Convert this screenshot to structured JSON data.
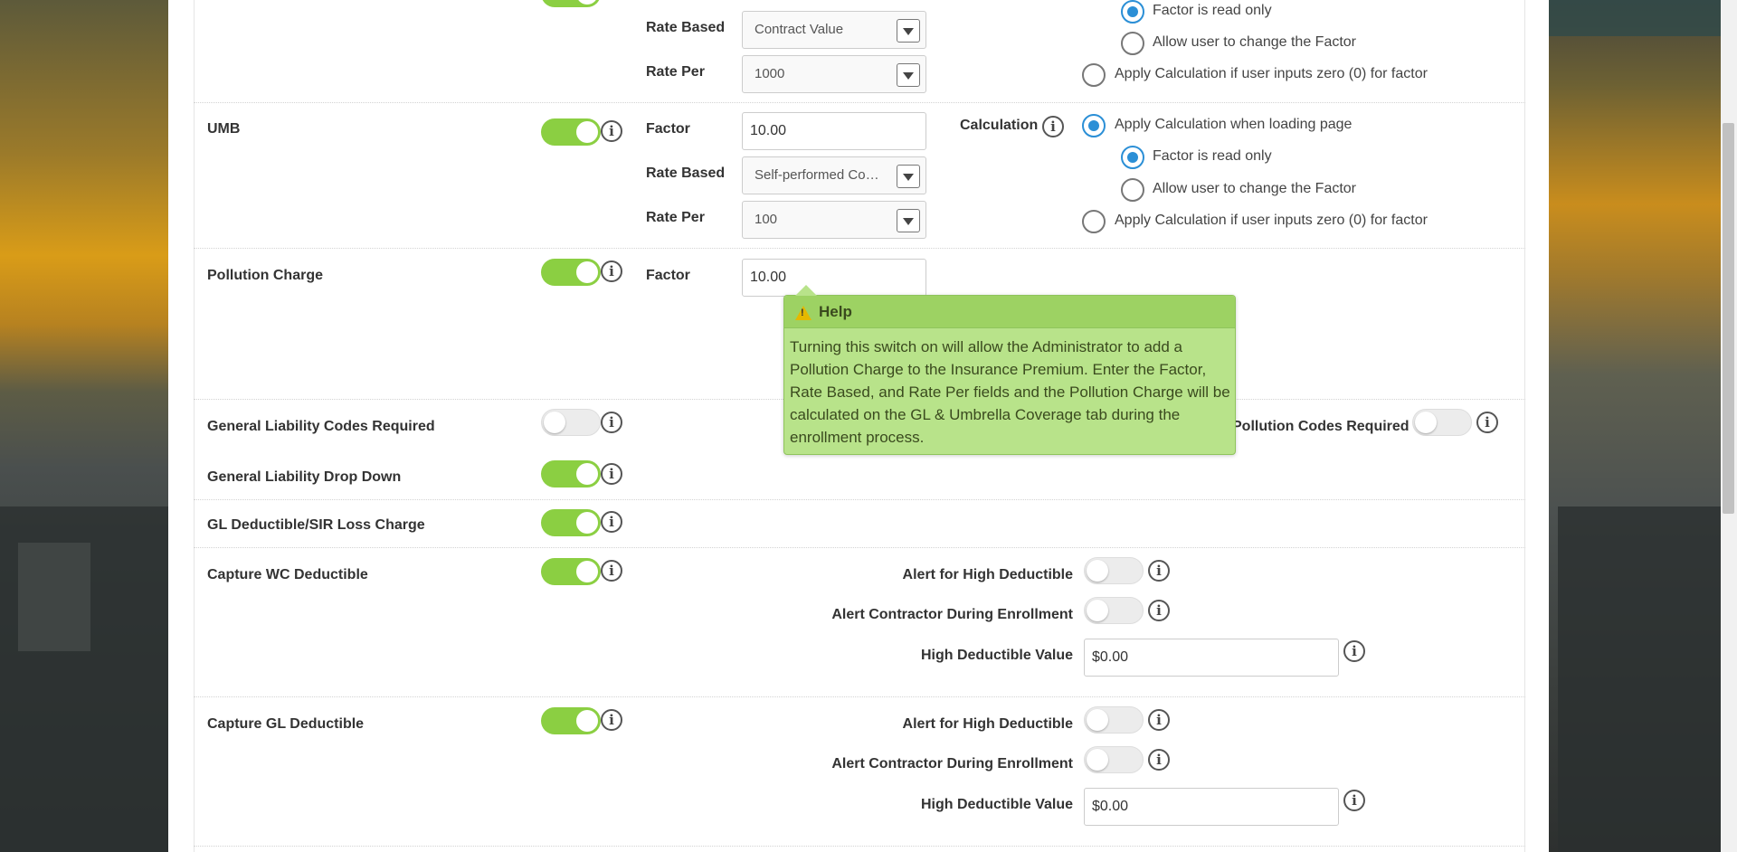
{
  "colors": {
    "toggle_on": "#8bcf42",
    "radio_selected": "#2b8fd6",
    "tooltip_bg": "#b8e38a"
  },
  "top_section": {
    "rate_based_label": "Rate Based",
    "rate_based_value": "Contract Value",
    "rate_per_label": "Rate Per",
    "rate_per_value": "1000",
    "radio_factor_read_only": "Factor is read only",
    "radio_allow_change": "Allow user to change the Factor",
    "radio_apply_zero": "Apply Calculation if user inputs zero (0) for factor",
    "factor_read_only_selected": true
  },
  "umb": {
    "label": "UMB",
    "enabled": true,
    "factor_label": "Factor",
    "factor_value": "10.00",
    "rate_based_label": "Rate Based",
    "rate_based_value": "Self-performed Contr...",
    "rate_per_label": "Rate Per",
    "rate_per_value": "100",
    "calculation_label": "Calculation",
    "radio_loading_page": "Apply Calculation when loading page",
    "radio_factor_read_only": "Factor is read only",
    "radio_allow_change": "Allow user to change the Factor",
    "radio_apply_zero": "Apply Calculation if user inputs zero (0) for factor"
  },
  "pollution": {
    "label": "Pollution Charge",
    "enabled": true,
    "factor_label": "Factor",
    "factor_value": "10.00"
  },
  "tooltip": {
    "title": "Help",
    "body": "Turning this switch on will allow the Administrator to add a Pollution Charge to the Insurance Premium. Enter the Factor, Rate Based, and Rate Per fields and the Pollution Charge will be calculated on the GL & Umbrella Coverage tab during the enrollment process."
  },
  "gl_codes": {
    "label": "General Liability Codes Required",
    "enabled": false
  },
  "pollution_codes": {
    "label": "Pollution Codes Required",
    "enabled": false
  },
  "gl_dropdown": {
    "label": "General Liability Drop Down",
    "enabled": true
  },
  "gl_deductible": {
    "label": "GL Deductible/SIR Loss Charge",
    "enabled": true
  },
  "wc_deductible": {
    "label": "Capture WC Deductible",
    "enabled": true,
    "alert_high_label": "Alert for High Deductible",
    "alert_contractor_label": "Alert Contractor During Enrollment",
    "high_value_label": "High Deductible Value",
    "high_value": "$0.00"
  },
  "gl_capture_deductible": {
    "label": "Capture GL Deductible",
    "enabled": true,
    "alert_high_label": "Alert for High Deductible",
    "alert_contractor_label": "Alert Contractor During Enrollment",
    "high_value_label": "High Deductible Value",
    "high_value": "$0.00"
  }
}
